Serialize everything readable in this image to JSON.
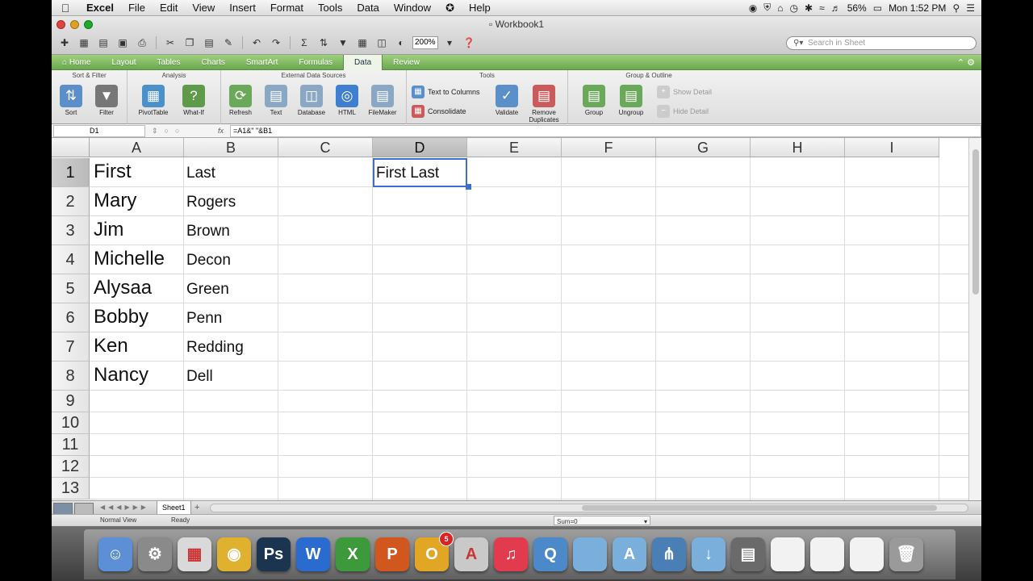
{
  "menubar": {
    "app": "Excel",
    "items": [
      "File",
      "Edit",
      "View",
      "Insert",
      "Format",
      "Tools",
      "Data",
      "Window"
    ],
    "script_icon": "script-icon",
    "help": "Help",
    "battery": "56%",
    "clock": "Mon 1:52 PM"
  },
  "window": {
    "title": "Workbook1"
  },
  "toolbar": {
    "zoom": "200%",
    "search_placeholder": "Search in Sheet"
  },
  "ribbon": {
    "tabs": [
      "Home",
      "Layout",
      "Tables",
      "Charts",
      "SmartArt",
      "Formulas",
      "Data",
      "Review"
    ],
    "active_tab": "Data",
    "groups": {
      "sort_filter": "Sort & Filter",
      "analysis": "Analysis",
      "external": "External Data Sources",
      "tools": "Tools",
      "group_outline": "Group & Outline"
    },
    "buttons": {
      "sort": "Sort",
      "filter": "Filter",
      "pivottable": "PivotTable",
      "whatif": "What-If",
      "refresh": "Refresh",
      "text": "Text",
      "database": "Database",
      "html": "HTML",
      "filemaker": "FileMaker",
      "text_to_columns": "Text to Columns",
      "consolidate": "Consolidate",
      "validate": "Validate",
      "remove_duplicates_1": "Remove",
      "remove_duplicates_2": "Duplicates",
      "group": "Group",
      "ungroup": "Ungroup",
      "show_detail": "Show Detail",
      "hide_detail": "Hide Detail"
    }
  },
  "formula_bar": {
    "name_box": "D1",
    "fx": "fx",
    "formula": "=A1&\" \"&B1"
  },
  "sheet": {
    "columns": [
      "A",
      "B",
      "C",
      "D",
      "E",
      "F",
      "G",
      "H",
      "I"
    ],
    "selected_column": "D",
    "rows": [
      "1",
      "2",
      "3",
      "4",
      "5",
      "6",
      "7",
      "8",
      "9",
      "10",
      "11",
      "12",
      "13"
    ],
    "selected_row": "1",
    "first_names": [
      "First",
      "Mary",
      "Jim",
      "Michelle",
      "Alysaa",
      "Bobby",
      "Ken",
      "Nancy"
    ],
    "last_names": [
      "Last",
      "Rogers",
      "Brown",
      "Decon",
      "Green",
      "Penn",
      "Redding",
      "Dell"
    ],
    "d1": "First Last"
  },
  "tabs_bar": {
    "sheet_tab": "Sheet1",
    "add": "+"
  },
  "status": {
    "view": "Normal View",
    "ready": "Ready",
    "sum": "Sum=0"
  },
  "dock": {
    "apps": [
      {
        "name": "finder-icon",
        "color": "#5d8fd6",
        "glyph": "☺"
      },
      {
        "name": "system-preferences-icon",
        "color": "#8a8a8a",
        "glyph": "⚙"
      },
      {
        "name": "launchpad-icon",
        "color": "#d9d9d9",
        "glyph": "▦"
      },
      {
        "name": "chrome-icon",
        "color": "#e0b12e",
        "glyph": "◉"
      },
      {
        "name": "photoshop-icon",
        "color": "#1b3551",
        "glyph": "Ps"
      },
      {
        "name": "word-icon",
        "color": "#2a6bd0",
        "glyph": "W"
      },
      {
        "name": "excel-icon",
        "color": "#3d9a3a",
        "glyph": "X"
      },
      {
        "name": "powerpoint-icon",
        "color": "#d2571e",
        "glyph": "P"
      },
      {
        "name": "outlook-icon",
        "color": "#e2a625",
        "glyph": "O"
      },
      {
        "name": "acrobat-icon",
        "color": "#c9c9c9",
        "glyph": "A"
      },
      {
        "name": "itunes-icon",
        "color": "#e23b4e",
        "glyph": "♫"
      },
      {
        "name": "quicktime-icon",
        "color": "#4c89c9",
        "glyph": "Q"
      },
      {
        "name": "folder-icon",
        "color": "#7aaedb",
        "glyph": ""
      },
      {
        "name": "folder-apps-icon",
        "color": "#7aaedb",
        "glyph": "A"
      },
      {
        "name": "folder-network-icon",
        "color": "#4a7fb6",
        "glyph": "⋔"
      },
      {
        "name": "folder-downloads-icon",
        "color": "#7aaedb",
        "glyph": "↓"
      },
      {
        "name": "disk-utility-icon",
        "color": "#6a6a6a",
        "glyph": "▤"
      },
      {
        "name": "document-icon-1",
        "color": "#f2f2f2",
        "glyph": ""
      },
      {
        "name": "document-icon-2",
        "color": "#f2f2f2",
        "glyph": ""
      },
      {
        "name": "document-icon-3",
        "color": "#f2f2f2",
        "glyph": ""
      },
      {
        "name": "trash-icon",
        "color": "#9a9a9a",
        "glyph": "🗑"
      }
    ],
    "outlook_badge": "5"
  },
  "colors": {
    "ribbon_green": "#6aa84f",
    "active_cell_border": "#3a6fd0"
  }
}
